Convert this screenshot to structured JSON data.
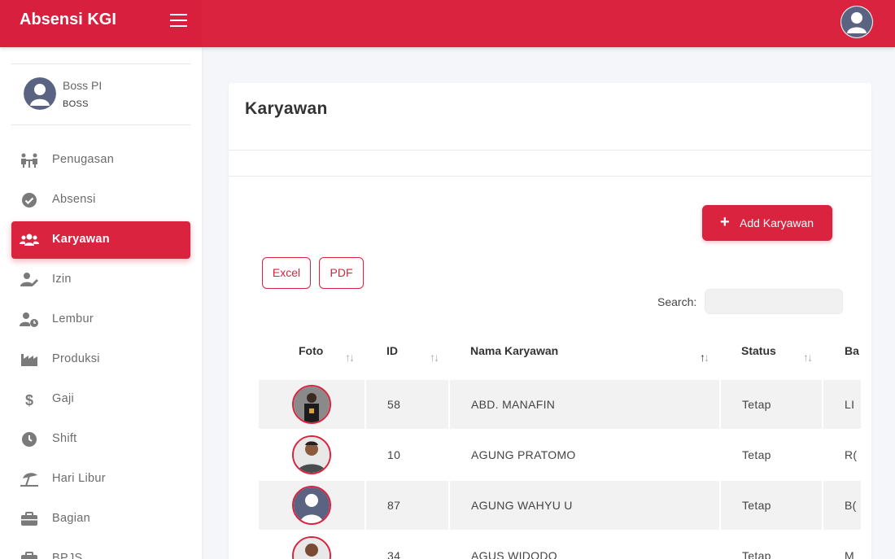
{
  "app": {
    "title": "Absensi KGI"
  },
  "user": {
    "name": "Boss PI",
    "role": "BOSS"
  },
  "menu": [
    {
      "label": "Penugasan",
      "icon": "people-meeting-icon",
      "active": false
    },
    {
      "label": "Absensi",
      "icon": "check-circle-icon",
      "active": false
    },
    {
      "label": "Karyawan",
      "icon": "users-icon",
      "active": true
    },
    {
      "label": "Izin",
      "icon": "user-edit-icon",
      "active": false
    },
    {
      "label": "Lembur",
      "icon": "user-clock-icon",
      "active": false
    },
    {
      "label": "Produksi",
      "icon": "industry-icon",
      "active": false
    },
    {
      "label": "Gaji",
      "icon": "dollar-icon",
      "active": false
    },
    {
      "label": "Shift",
      "icon": "clock-icon",
      "active": false
    },
    {
      "label": "Hari Libur",
      "icon": "umbrella-beach-icon",
      "active": false
    },
    {
      "label": "Bagian",
      "icon": "briefcase-icon",
      "active": false
    },
    {
      "label": "BPJS",
      "icon": "briefcase-medical-icon",
      "active": false
    }
  ],
  "page": {
    "title": "Karyawan"
  },
  "actions": {
    "add_label": "Add Karyawan",
    "excel_label": "Excel",
    "pdf_label": "PDF"
  },
  "search": {
    "label": "Search:",
    "value": "",
    "placeholder": ""
  },
  "table": {
    "columns": [
      "Foto",
      "ID",
      "Nama Karyawan",
      "Status",
      "Ba"
    ],
    "rows": [
      {
        "photo": "employee-photo",
        "id": "58",
        "name": "ABD. MANAFIN",
        "status": "Tetap",
        "bagian": "LI"
      },
      {
        "photo": "employee-photo",
        "id": "10",
        "name": "AGUNG PRATOMO",
        "status": "Tetap",
        "bagian": "R("
      },
      {
        "photo": "default-avatar",
        "id": "87",
        "name": "AGUNG WAHYU U",
        "status": "Tetap",
        "bagian": "B("
      },
      {
        "photo": "employee-photo",
        "id": "34",
        "name": "AGUS WIDODO",
        "status": "Tetap",
        "bagian": "M"
      }
    ]
  },
  "colors": {
    "primary": "#d9233f",
    "avatar": "#5a6482"
  }
}
